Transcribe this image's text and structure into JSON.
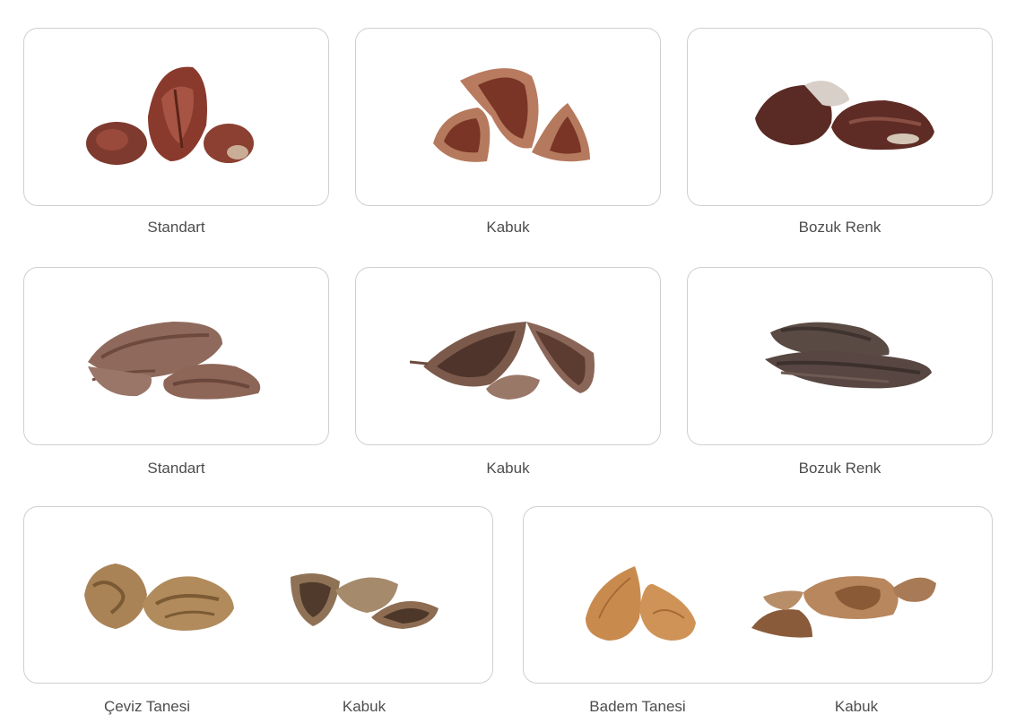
{
  "rows": [
    {
      "captions": [
        "Standart",
        "Kabuk",
        "Bozuk Renk"
      ]
    },
    {
      "captions": [
        "Standart",
        "Kabuk",
        "Bozuk Renk"
      ]
    }
  ],
  "bottom": {
    "walnut": {
      "kernel_label": "Çeviz Tanesi",
      "shell_label": "Kabuk"
    },
    "almond": {
      "kernel_label": "Badem Tanesi",
      "shell_label": "Kabuk"
    }
  },
  "icons": [
    "pecan-kernel-red-icon",
    "pecan-shell-red-icon",
    "pecan-discolored-red-icon",
    "pecan-kernel-brown-icon",
    "pecan-shell-brown-icon",
    "pecan-discolored-brown-icon",
    "walnut-kernel-icon",
    "walnut-shell-icon",
    "almond-kernel-icon",
    "almond-shell-icon"
  ]
}
